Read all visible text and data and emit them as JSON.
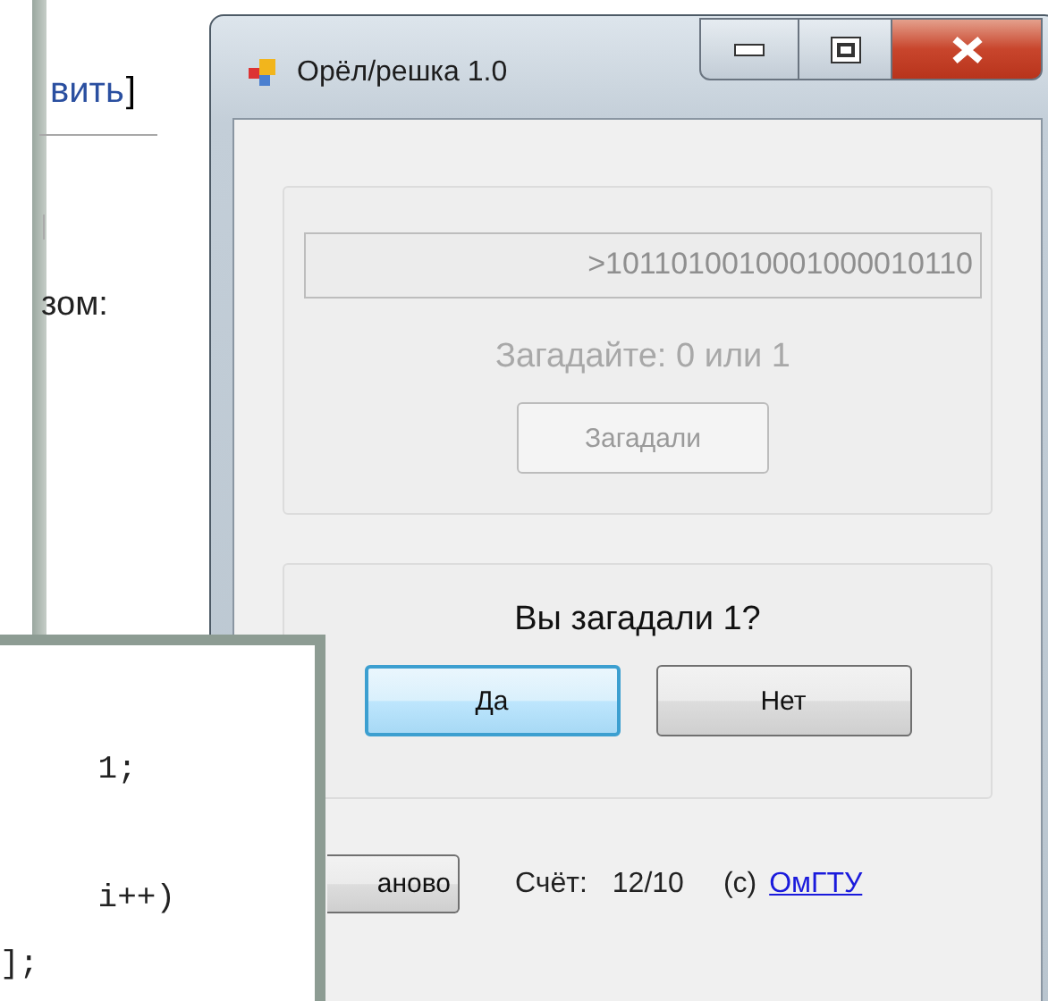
{
  "background_page": {
    "link_text": "вить",
    "bracket": "]",
    "label": "зом:"
  },
  "dialog": {
    "title": "Орёл/решка 1.0",
    "sequence_field": {
      "value": ">1011010010001000010110",
      "disabled": true
    },
    "prompt": {
      "text": "Загадайте: 0 или 1",
      "disabled": true
    },
    "guess_button": {
      "label": "Загадали",
      "disabled": true
    },
    "question": "Вы загадали 1?",
    "answer_buttons": [
      {
        "label": "Да",
        "focused": true
      },
      {
        "label": "Нет",
        "focused": false
      }
    ],
    "restart_button": {
      "label": "аново"
    },
    "score_label": "Счёт:",
    "score": "12/10",
    "copyright": "(c)",
    "link": "ОмГТУ"
  },
  "code_snippet": {
    "lines": [
      " 1;",
      " i++)",
      "];"
    ]
  }
}
